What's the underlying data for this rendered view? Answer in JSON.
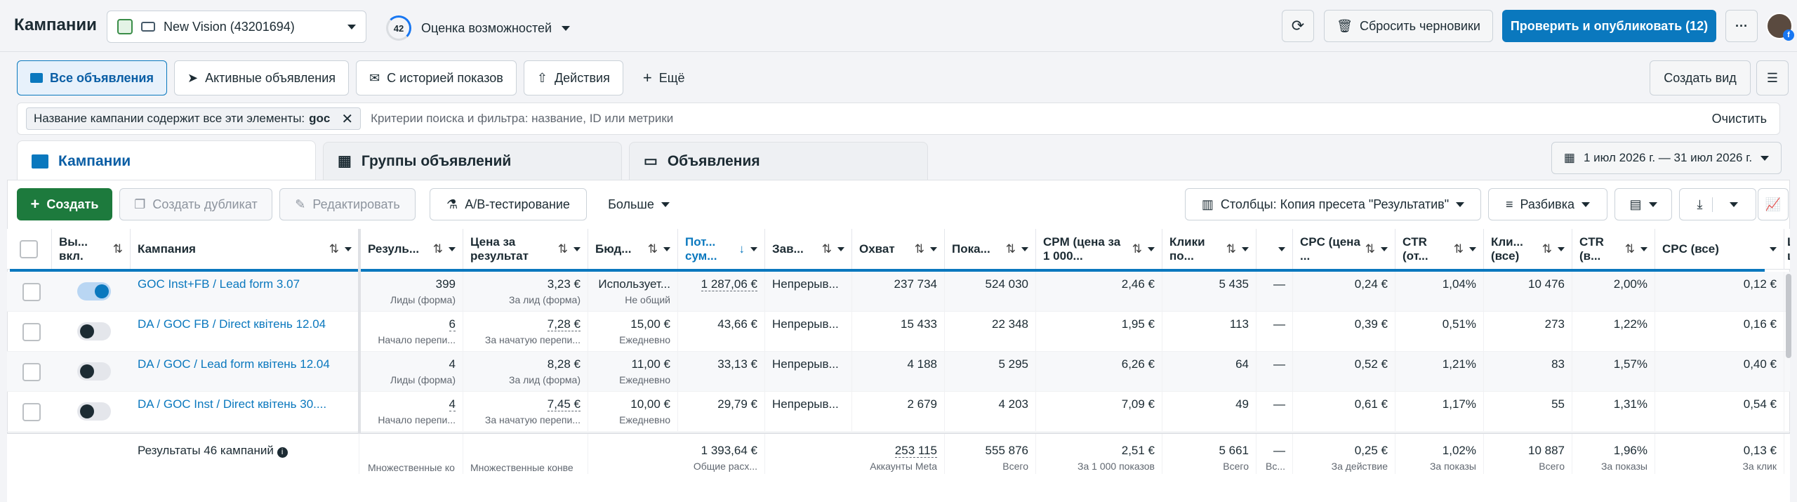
{
  "header": {
    "title": "Кампании",
    "account": "New Vision (43201694)",
    "opportunity_score": "42",
    "opportunity_label": "Оценка возможностей",
    "discard_label": "Сбросить черновики",
    "publish_label": "Проверить и опубликовать (12)",
    "more_label": "···"
  },
  "filter_tabs": [
    "Все объявления",
    "Активные объявления",
    "С историей показов",
    "Действия",
    "Ещё"
  ],
  "create_view": "Создать вид",
  "search": {
    "chip_prefix": "Название кампании содержит все эти элементы:",
    "chip_value": "goc",
    "placeholder": "Критерии поиска и фильтра: название, ID или метрики",
    "clear": "Очистить"
  },
  "levels": [
    "Кампании",
    "Группы объявлений",
    "Объявления"
  ],
  "date_range": "1 июл 2026 г. — 31 июл 2026 г.",
  "toolbar": {
    "create": "Создать",
    "duplicate": "Создать дубликат",
    "edit": "Редактировать",
    "ab_test": "A/B-тестирование",
    "more": "Больше",
    "columns": "Столбцы: Копия пресета \"Результатив\"",
    "breakdown": "Разбивка"
  },
  "columns": [
    "Вы... вкл.",
    "Кампания",
    "Резуль...",
    "Цена за результат",
    "Бюд...",
    "Пот... сум...",
    "Зав...",
    "Охват",
    "Пока...",
    "CPM (цена за 1 000...",
    "Клики по...",
    "",
    "CPC (цена ...",
    "CTR (от...",
    "Кли... (все)",
    "CTR (в...",
    "CPC (все)",
    "Ц ц"
  ],
  "rows": [
    {
      "name": "GOC Inst+FB / Lead form 3.07",
      "on": true,
      "results": "399",
      "results_sub": "Лиды (форма)",
      "cpr": "3,23 €",
      "cpr_sub": "За лид (форма)",
      "budget": "Использует...",
      "budget_sub": "Не общий",
      "spent": "1 287,06 €",
      "end": "Непрерыв...",
      "reach": "237 734",
      "impr": "524 030",
      "cpm": "2,46 €",
      "clicks": "5 435",
      "dash": "—",
      "cpc": "0,24 €",
      "ctr": "1,04%",
      "clicks_all": "10 476",
      "ctr_all": "2,00%",
      "cpc_all": "0,12 €"
    },
    {
      "name": "DA / GOC FB / Direct квітень 12.04",
      "on": false,
      "results": "6",
      "results_sub": "Начало перепи...",
      "cpr": "7,28 €",
      "cpr_sub": "За начатую перепи...",
      "budget": "15,00 €",
      "budget_sub": "Ежедневно",
      "spent": "43,66 €",
      "end": "Непрерыв...",
      "reach": "15 433",
      "impr": "22 348",
      "cpm": "1,95 €",
      "clicks": "113",
      "dash": "—",
      "cpc": "0,39 €",
      "ctr": "0,51%",
      "clicks_all": "273",
      "ctr_all": "1,22%",
      "cpc_all": "0,16 €"
    },
    {
      "name": "DA / GOC / Lead form квітень 12.04",
      "on": false,
      "results": "4",
      "results_sub": "Лиды (форма)",
      "cpr": "8,28 €",
      "cpr_sub": "За лид (форма)",
      "budget": "11,00 €",
      "budget_sub": "Ежедневно",
      "spent": "33,13 €",
      "end": "Непрерыв...",
      "reach": "4 188",
      "impr": "5 295",
      "cpm": "6,26 €",
      "clicks": "64",
      "dash": "—",
      "cpc": "0,52 €",
      "ctr": "1,21%",
      "clicks_all": "83",
      "ctr_all": "1,57%",
      "cpc_all": "0,40 €"
    },
    {
      "name": "DA / GOC Inst / Direct квітень 30....",
      "on": false,
      "results": "4",
      "results_sub": "Начало перепи...",
      "cpr": "7,45 €",
      "cpr_sub": "За начатую перепи...",
      "budget": "10,00 €",
      "budget_sub": "Ежедневно",
      "spent": "29,79 €",
      "end": "Непрерыв...",
      "reach": "2 679",
      "impr": "4 203",
      "cpm": "7,09 €",
      "clicks": "49",
      "dash": "—",
      "cpc": "0,61 €",
      "ctr": "1,17%",
      "clicks_all": "55",
      "ctr_all": "1,31%",
      "cpc_all": "0,54 €"
    }
  ],
  "totals": {
    "label": "Результаты 46 кампаний",
    "results_sub": "Множественные ко",
    "cpr_sub": "Множественные конве",
    "spent": "1 393,64 €",
    "spent_sub": "Общие расх...",
    "reach": "253 115",
    "reach_sub": "Аккаунты Meta",
    "impr": "555 876",
    "impr_sub": "Всего",
    "cpm": "2,51 €",
    "cpm_sub": "За 1 000 показов",
    "clicks": "5 661",
    "clicks_sub": "Всего",
    "dash": "—",
    "dash_sub": "Вс...",
    "cpc": "0,25 €",
    "cpc_sub": "За действие",
    "ctr": "1,02%",
    "ctr_sub": "За показы",
    "clicks_all": "10 887",
    "clicks_all_sub": "Всего",
    "ctr_all": "1,96%",
    "ctr_all_sub": "За показы",
    "cpc_all": "0,13 €",
    "cpc_all_sub": "За клик"
  }
}
